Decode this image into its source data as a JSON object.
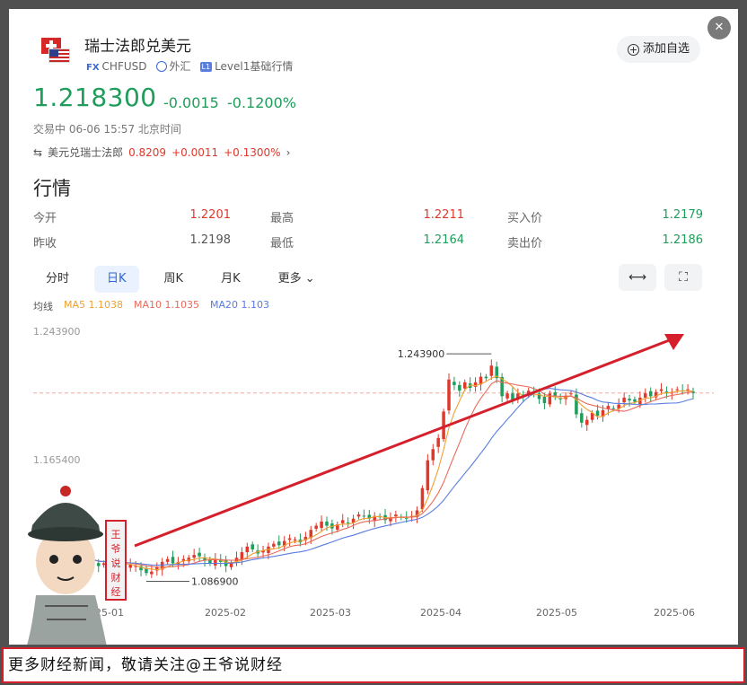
{
  "header": {
    "title": "瑞士法郎兑美元",
    "fx_tag": "FX",
    "symbol": "CHFUSD",
    "market": "外汇",
    "level_badge": "L1",
    "level": "Level1基础行情",
    "watch_label": "添加自选",
    "close_icon": "close-icon"
  },
  "quote": {
    "price": "1.218300",
    "change": "-0.0015",
    "change_pct": "-0.1200%",
    "status": "交易中 06-06 15:57 北京时间",
    "cross_name": "美元兑瑞士法郎",
    "cross_price": "0.8209",
    "cross_change": "+0.0011",
    "cross_pct": "+0.1300%"
  },
  "section_title": "行情",
  "stats": [
    {
      "label": "今开",
      "value": "1.2201",
      "color": "#e0382b"
    },
    {
      "label": "最高",
      "value": "1.2211",
      "color": "#e0382b"
    },
    {
      "label": "买入价",
      "value": "1.2179",
      "color": "#1e9e5a"
    },
    {
      "label": "昨收",
      "value": "1.2198",
      "color": "#555555"
    },
    {
      "label": "最低",
      "value": "1.2164",
      "color": "#1e9e5a"
    },
    {
      "label": "卖出价",
      "value": "1.2186",
      "color": "#1e9e5a"
    }
  ],
  "tabs": [
    "分时",
    "日K",
    "周K",
    "月K",
    "更多"
  ],
  "active_tab": "日K",
  "ma": {
    "label": "均线",
    "ma5": "MA5 1.1038",
    "ma10": "MA10 1.1035",
    "ma20": "MA20 1.103",
    "ma5_color": "#f0a030",
    "ma10_color": "#e86a5a",
    "ma20_color": "#5a7de0"
  },
  "chart_data": {
    "type": "candlestick",
    "ylabels": [
      "1.243900",
      "1.165400"
    ],
    "high_marker": "1.243900",
    "low_marker": "1.086900",
    "xlabels": [
      "2025-01",
      "2025-02",
      "2025-03",
      "2025-04",
      "2025-05",
      "2025-06"
    ],
    "ylim": [
      1.075,
      1.262
    ],
    "up_color": "#e0382b",
    "down_color": "#1e9e5a",
    "trend_arrow_color": "#d51f2b",
    "closes": [
      1.101,
      1.098,
      1.097,
      1.094,
      1.096,
      1.099,
      1.097,
      1.094,
      1.092,
      1.095,
      1.094,
      1.091,
      1.089,
      1.09,
      1.093,
      1.097,
      1.099,
      1.096,
      1.097,
      1.099,
      1.1,
      1.102,
      1.101,
      1.098,
      1.096,
      1.099,
      1.097,
      1.094,
      1.096,
      1.1,
      1.104,
      1.108,
      1.106,
      1.103,
      1.105,
      1.108,
      1.11,
      1.109,
      1.112,
      1.114,
      1.113,
      1.111,
      1.115,
      1.12,
      1.123,
      1.126,
      1.123,
      1.121,
      1.124,
      1.127,
      1.125,
      1.128,
      1.131,
      1.13,
      1.128,
      1.13,
      1.129,
      1.127,
      1.129,
      1.131,
      1.129,
      1.128,
      1.13,
      1.134,
      1.15,
      1.17,
      1.178,
      1.186,
      1.205,
      1.228,
      1.224,
      1.22,
      1.226,
      1.222,
      1.226,
      1.23,
      1.229,
      1.238,
      1.229,
      1.216,
      1.218,
      1.213,
      1.218,
      1.216,
      1.22,
      1.218,
      1.214,
      1.211,
      1.218,
      1.216,
      1.214,
      1.216,
      1.218,
      1.203,
      1.197,
      1.199,
      1.204,
      1.202,
      1.206,
      1.209,
      1.207,
      1.21,
      1.215,
      1.213,
      1.212,
      1.215,
      1.218,
      1.216,
      1.219,
      1.221,
      1.218,
      1.219,
      1.221,
      1.22,
      1.221,
      1.2183
    ]
  },
  "footer": "更多财经新闻，敬请关注@王爷说财经",
  "watermark": "王爷说财经"
}
